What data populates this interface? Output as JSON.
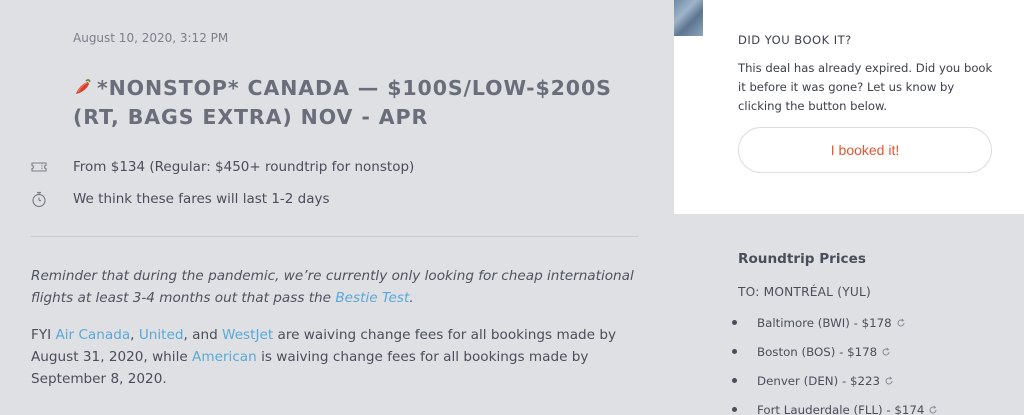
{
  "post": {
    "date": "August 10, 2020, 3:12 PM",
    "title": "*NONSTOP* CANADA — $100S/LOW-$200S (RT, BAGS EXTRA) NOV - APR",
    "price_line": "From $134 (Regular: $450+ roundtrip for nonstop)",
    "last_line": "We think these fares will last 1-2 days",
    "reminder_text": "Reminder that during the pandemic, we’re currently only looking for cheap international flights at least 3-4 months out that pass the ",
    "reminder_link": "Bestie Test",
    "reminder_end": ".",
    "fyi_start": "FYI ",
    "fyi_link1": "Air Canada",
    "fyi_sep1": ", ",
    "fyi_link2": "United",
    "fyi_sep2": ", and ",
    "fyi_link3": "WestJet",
    "fyi_mid": " are waiving change fees for all bookings made by August 31, 2020, while ",
    "fyi_link4": "American",
    "fyi_end": " is waiving change fees for all bookings made by September 8, 2020."
  },
  "booking": {
    "heading": "DID YOU BOOK IT?",
    "text": "This deal has already expired. Did you book it before it was gone? Let us know by clicking the button below.",
    "button_label": "I booked it!"
  },
  "prices": {
    "heading": "Roundtrip Prices",
    "to_label": "TO: MONTRÉAL (YUL)",
    "items": [
      {
        "label": "Baltimore (BWI) - $178"
      },
      {
        "label": "Boston (BOS) - $178"
      },
      {
        "label": "Denver (DEN) - $223"
      },
      {
        "label": "Fort Lauderdale (FLL) - $174"
      }
    ]
  },
  "colors": {
    "accent_link": "#5aa9d6",
    "button_text": "#e4562f",
    "background": "#dfe0e4"
  },
  "icons": {
    "title": "chili-pepper-icon",
    "price": "ticket-icon",
    "duration": "stopwatch-icon",
    "refresh": "refresh-icon"
  }
}
